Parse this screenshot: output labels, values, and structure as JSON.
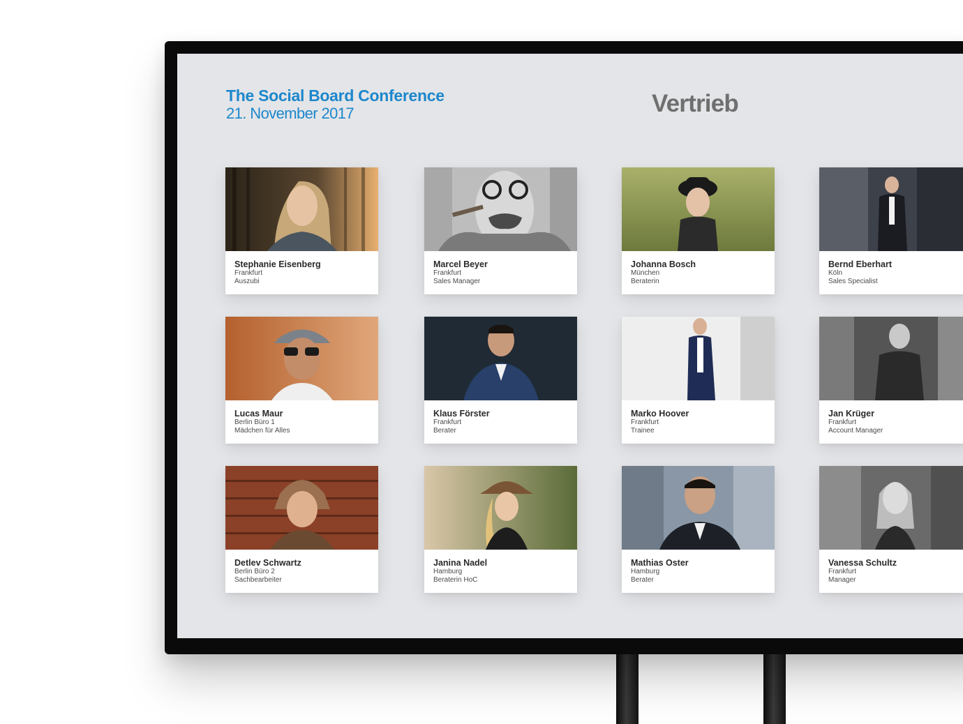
{
  "header": {
    "conference_title": "The Social Board Conference",
    "conference_date": "21. November 2017",
    "department": "Vertrieb"
  },
  "colors": {
    "accent": "#1d87cc",
    "department_text": "#6f6f6f",
    "screen_background": "#e4e5e8",
    "bezel": "#0a0a0a"
  },
  "people": [
    {
      "name": "Stephanie Eisenberg",
      "city": "Frankfurt",
      "role": "Auszubi"
    },
    {
      "name": "Marcel Beyer",
      "city": "Frankfurt",
      "role": "Sales Manager"
    },
    {
      "name": "Johanna Bosch",
      "city": "München",
      "role": "Beraterin"
    },
    {
      "name": "Bernd Eberhart",
      "city": "Köln",
      "role": "Sales Specialist"
    },
    {
      "name": "Lucas Maur",
      "city": "Berlin Büro 1",
      "role": "Mädchen für Alles"
    },
    {
      "name": "Klaus Förster",
      "city": "Frankfurt",
      "role": "Berater"
    },
    {
      "name": "Marko Hoover",
      "city": "Frankfurt",
      "role": "Trainee"
    },
    {
      "name": "Jan Krüger",
      "city": "Frankfurt",
      "role": "Account Manager"
    },
    {
      "name": "Detlev Schwartz",
      "city": "Berlin Büro 2",
      "role": "Sachbearbeiter"
    },
    {
      "name": "Janina Nadel",
      "city": "Hamburg",
      "role": "Beraterin HoC"
    },
    {
      "name": "Mathias Oster",
      "city": "Hamburg",
      "role": "Berater"
    },
    {
      "name": "Vanessa Schultz",
      "city": "Frankfurt",
      "role": "Manager"
    }
  ]
}
